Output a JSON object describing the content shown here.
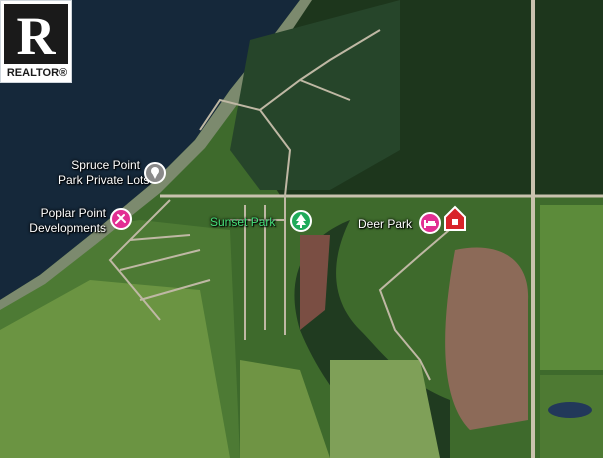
{
  "logo": {
    "wordmark": "REALTOR",
    "registered": "®",
    "icon": "realtor-r-icon"
  },
  "labels": {
    "spruce_point_line1": "Spruce Point",
    "spruce_point_line2": "Park Private Lots",
    "poplar_point_line1": "Poplar Point",
    "poplar_point_line2": "Developments",
    "sunset_park": "Sunset Park",
    "deer_park": "Deer Park"
  },
  "icons": {
    "spruce_point": "location-pin-icon",
    "poplar_point": "tools-pin-icon",
    "sunset_park": "tree-pin-icon",
    "deer_park": "lodging-pin-icon",
    "listing": "house-marker-icon"
  },
  "colors": {
    "water": "#15283a",
    "forest": "#1e3a1e",
    "field": "#5f8a3a",
    "road": "#c9c2ae",
    "park_label": "#46e07a",
    "poi_pink": "#e22e93",
    "poi_grey": "#8a8a8a",
    "listing_red": "#d8232a"
  }
}
